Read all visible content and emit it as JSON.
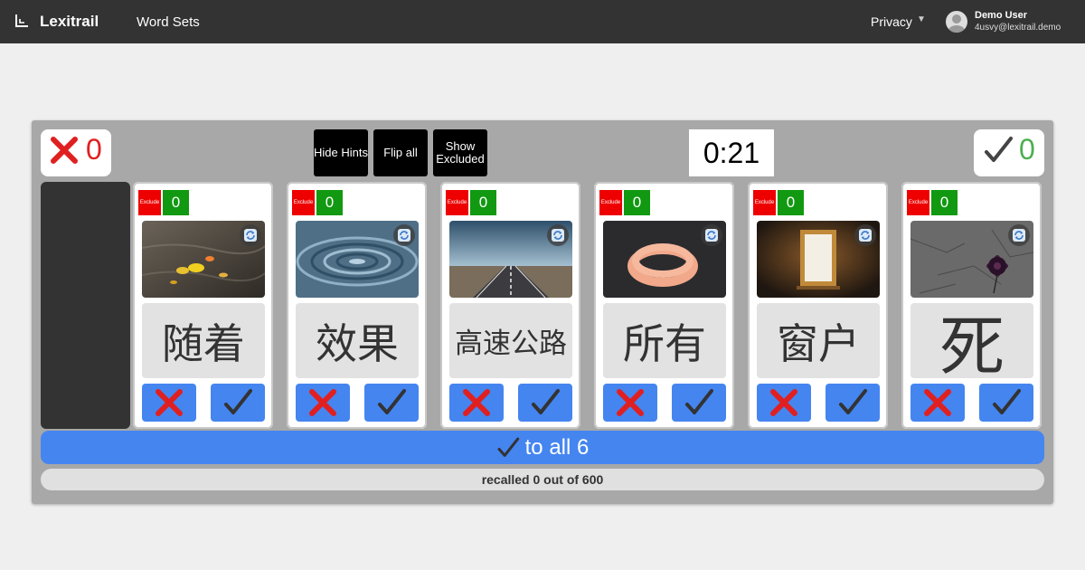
{
  "nav": {
    "brand": "Lexitrail",
    "word_sets": "Word Sets",
    "privacy": "Privacy",
    "user_name": "Demo User",
    "user_email": "4usvy@lexitrail.demo"
  },
  "scores": {
    "wrong": "0",
    "right": "0"
  },
  "controls": {
    "hide_hints": "Hide Hints",
    "flip_all": "Flip all",
    "show_excluded": "Show Excluded"
  },
  "timer": "0:21",
  "cards": [
    {
      "word": "随着",
      "count": "0",
      "exclude": "Exclude",
      "image": "leaves-on-water"
    },
    {
      "word": "效果",
      "count": "0",
      "exclude": "Exclude",
      "image": "water-ripples"
    },
    {
      "word": "高速公路",
      "count": "0",
      "exclude": "Exclude",
      "image": "highway"
    },
    {
      "word": "所有",
      "count": "0",
      "exclude": "Exclude",
      "image": "rings"
    },
    {
      "word": "窗户",
      "count": "0",
      "exclude": "Exclude",
      "image": "window-frame"
    },
    {
      "word": "死",
      "count": "0",
      "exclude": "Exclude",
      "image": "dead-flower"
    }
  ],
  "to_all": {
    "label": "to all 6"
  },
  "progress": {
    "text": "recalled 0 out of 600",
    "recalled": 0,
    "total": 600
  },
  "colors": {
    "accent": "#4585f0",
    "wrong": "#e02020",
    "right": "#4caf50",
    "exclude": "#ee0000",
    "count": "#119911"
  }
}
